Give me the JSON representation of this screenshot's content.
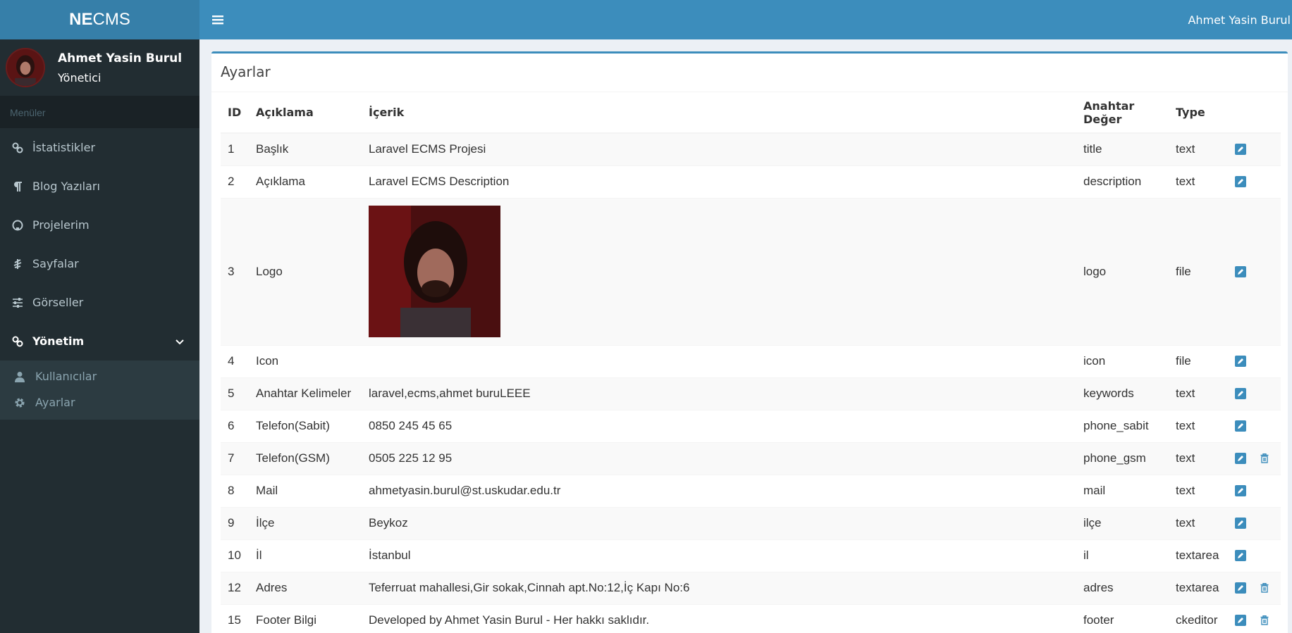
{
  "brand": {
    "bold": "NE",
    "rest": "CMS"
  },
  "user": {
    "name": "Ahmet Yasin Burul",
    "role": "Yönetici"
  },
  "sidebar": {
    "header": "Menüler",
    "items": [
      {
        "label": "İstatistikler",
        "icon": "link-icon"
      },
      {
        "label": "Blog Yazıları",
        "icon": "paragraph-icon"
      },
      {
        "label": "Projelerim",
        "icon": "github-icon"
      },
      {
        "label": "Sayfalar",
        "icon": "leaf-icon"
      },
      {
        "label": "Görseller",
        "icon": "sliders-icon"
      },
      {
        "label": "Yönetim",
        "icon": "link-icon"
      }
    ],
    "submenu": [
      {
        "label": "Kullanıcılar",
        "icon": "user-icon"
      },
      {
        "label": "Ayarlar",
        "icon": "gear-icon"
      }
    ]
  },
  "topbar": {
    "user_name": "Ahmet Yasin Burul"
  },
  "box": {
    "title": "Ayarlar"
  },
  "table": {
    "headers": [
      "ID",
      "Açıklama",
      "İçerik",
      "Anahtar Değer",
      "Type"
    ],
    "rows": [
      {
        "id": "1",
        "desc": "Başlık",
        "content": "Laravel ECMS Projesi",
        "key": "title",
        "type": "text",
        "delete": false
      },
      {
        "id": "2",
        "desc": "Açıklama",
        "content": "Laravel ECMS Description",
        "key": "description",
        "type": "text",
        "delete": false
      },
      {
        "id": "3",
        "desc": "Logo",
        "content": "",
        "key": "logo",
        "type": "file",
        "delete": false
      },
      {
        "id": "4",
        "desc": "Icon",
        "content": "",
        "key": "icon",
        "type": "file",
        "delete": false
      },
      {
        "id": "5",
        "desc": "Anahtar Kelimeler",
        "content": "laravel,ecms,ahmet buruLEEE",
        "key": "keywords",
        "type": "text",
        "delete": false
      },
      {
        "id": "6",
        "desc": "Telefon(Sabit)",
        "content": "0850 245 45 65",
        "key": "phone_sabit",
        "type": "text",
        "delete": false
      },
      {
        "id": "7",
        "desc": "Telefon(GSM)",
        "content": "0505 225 12 95",
        "key": "phone_gsm",
        "type": "text",
        "delete": true
      },
      {
        "id": "8",
        "desc": "Mail",
        "content": "ahmetyasin.burul@st.uskudar.edu.tr",
        "key": "mail",
        "type": "text",
        "delete": false
      },
      {
        "id": "9",
        "desc": "İlçe",
        "content": "Beykoz",
        "key": "ilçe",
        "type": "text",
        "delete": false
      },
      {
        "id": "10",
        "desc": "İl",
        "content": "İstanbul",
        "key": "il",
        "type": "textarea",
        "delete": false
      },
      {
        "id": "12",
        "desc": "Adres",
        "content": "Teferruat mahallesi,Gir sokak,Cinnah apt.No:12,İç Kapı No:6",
        "key": "adres",
        "type": "textarea",
        "delete": true
      },
      {
        "id": "15",
        "desc": "Footer Bilgi",
        "content": "Developed by Ahmet Yasin Burul - Her hakkı saklıdır.",
        "key": "footer",
        "type": "ckeditor",
        "delete": true
      }
    ]
  },
  "colors": {
    "primary": "#3c8dbc",
    "sidebar": "#222d32",
    "brand": "#367fa9"
  }
}
